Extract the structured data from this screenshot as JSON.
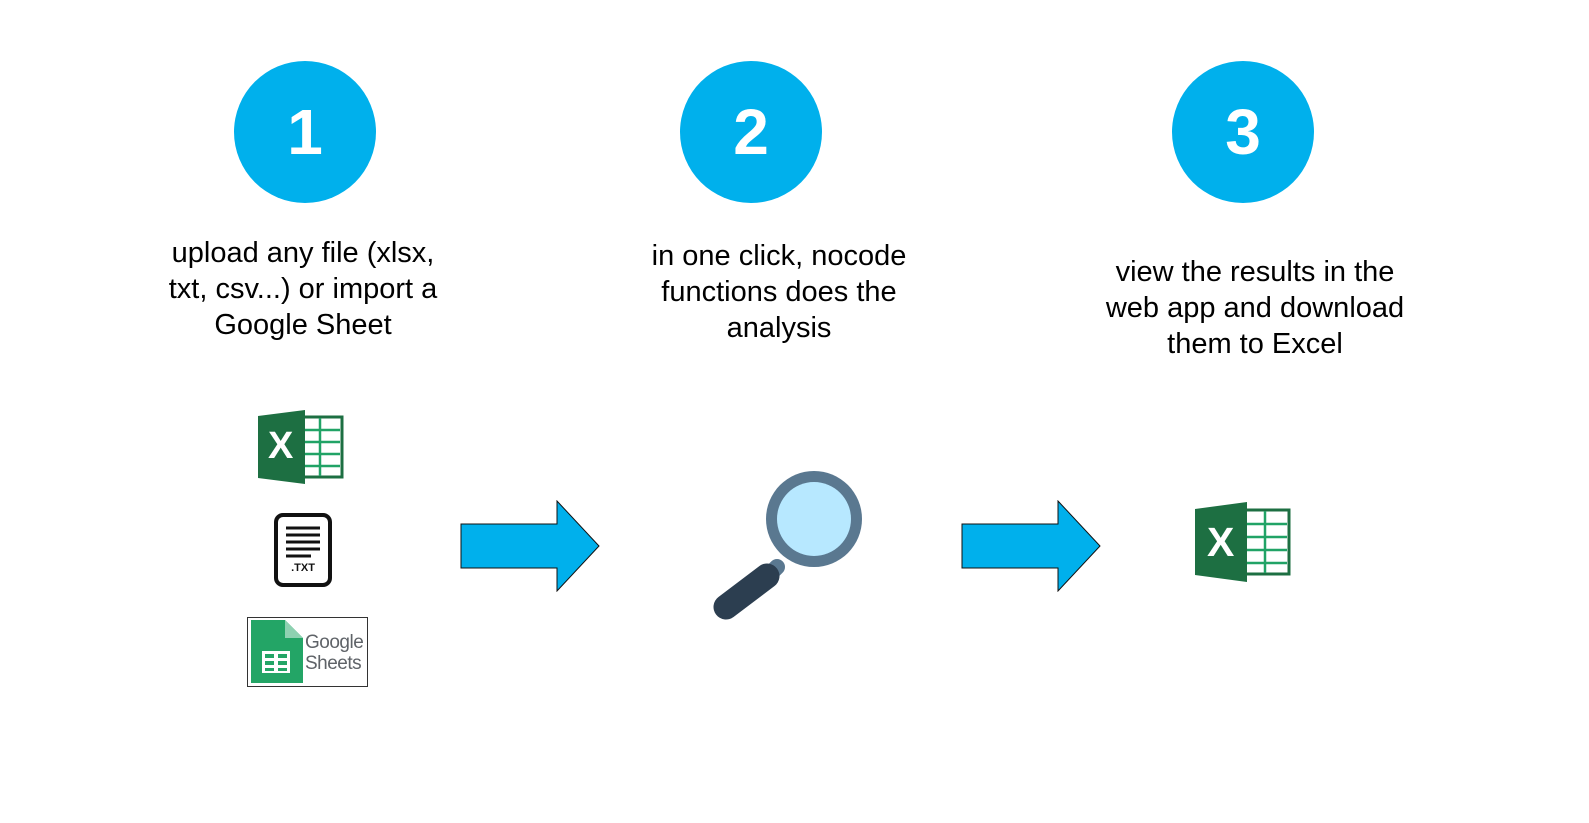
{
  "colors": {
    "accent": "#00b0ec",
    "excel_dark": "#1d6f42",
    "excel_light": "#21a366",
    "sheets_green": "#23a566",
    "magnifier_ring": "#5a7890",
    "magnifier_lens": "#b7e8ff",
    "magnifier_handle": "#2c3e50"
  },
  "steps": [
    {
      "number": "1",
      "text": "upload any file (xlsx,\ntxt, csv...) or import a\nGoogle Sheet"
    },
    {
      "number": "2",
      "text": "in one click, nocode\nfunctions does the\nanalysis"
    },
    {
      "number": "3",
      "text": "view the results in the\nweb app and download\nthem to Excel"
    }
  ],
  "icons": {
    "excel": {
      "name": "excel-icon",
      "letter": "X"
    },
    "txt": {
      "name": "txt-file-icon",
      "label": ".TXT"
    },
    "sheets": {
      "name": "google-sheets-icon",
      "line1": "Google",
      "line2": "Sheets"
    },
    "magnifier": {
      "name": "magnifying-glass-icon"
    },
    "arrow": {
      "name": "arrow-right-icon"
    }
  }
}
